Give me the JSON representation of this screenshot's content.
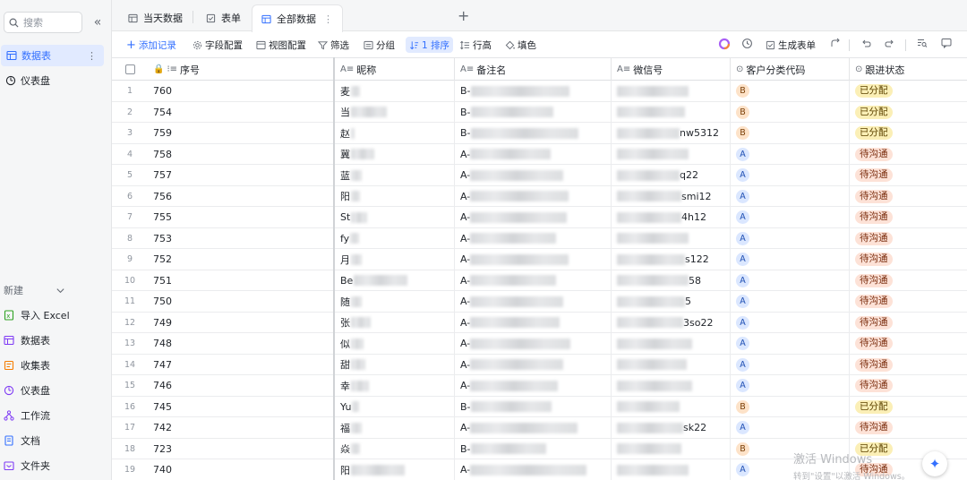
{
  "sidebar": {
    "search_placeholder": "搜索",
    "items": [
      {
        "label": "数据表",
        "icon": "table-icon",
        "active": true
      },
      {
        "label": "仪表盘",
        "icon": "dashboard-icon",
        "active": false
      }
    ],
    "new_label": "新建",
    "new_items": [
      {
        "label": "导入 Excel",
        "icon": "excel-icon",
        "color": "#2ea121"
      },
      {
        "label": "数据表",
        "icon": "table-icon",
        "color": "#7f3bf5"
      },
      {
        "label": "收集表",
        "icon": "form-icon",
        "color": "#f57c00"
      },
      {
        "label": "仪表盘",
        "icon": "dashboard-icon",
        "color": "#7f3bf5"
      },
      {
        "label": "工作流",
        "icon": "workflow-icon",
        "color": "#7f3bf5"
      },
      {
        "label": "文档",
        "icon": "doc-icon",
        "color": "#3370ff"
      },
      {
        "label": "文件夹",
        "icon": "folder-icon",
        "color": "#7f3bf5"
      }
    ]
  },
  "tabs": [
    {
      "label": "当天数据",
      "icon": "table-icon",
      "active": false
    },
    {
      "label": "表单",
      "icon": "form-icon",
      "active": false
    },
    {
      "label": "全部数据",
      "icon": "table-icon",
      "active": true
    }
  ],
  "toolbar": {
    "add_record": "添加记录",
    "field_config": "字段配置",
    "view_config": "视图配置",
    "filter": "筛选",
    "group": "分组",
    "sort": "1 排序",
    "row_height": "行高",
    "fill_color": "填色",
    "generate_form": "生成表单"
  },
  "columns": [
    "序号",
    "昵称",
    "备注名",
    "微信号",
    "客户分类代码",
    "跟进状态"
  ],
  "rows": [
    {
      "idx": "1",
      "num": "760",
      "nick": "麦",
      "remark": "B-",
      "wechat": "",
      "code": "B",
      "status": "已分配"
    },
    {
      "idx": "2",
      "num": "754",
      "nick": "当",
      "remark": "B-",
      "wechat": "",
      "code": "B",
      "status": "已分配"
    },
    {
      "idx": "3",
      "num": "759",
      "nick": "赵",
      "remark": "B-",
      "wechat": "nw5312",
      "code": "B",
      "status": "已分配"
    },
    {
      "idx": "4",
      "num": "758",
      "nick": "冀",
      "remark": "A-",
      "wechat": "",
      "code": "A",
      "status": "待沟通"
    },
    {
      "idx": "5",
      "num": "757",
      "nick": "蓝",
      "remark": "A-",
      "wechat": "q22",
      "code": "A",
      "status": "待沟通"
    },
    {
      "idx": "6",
      "num": "756",
      "nick": "阳",
      "remark": "A-",
      "wechat": "smi12",
      "code": "A",
      "status": "待沟通"
    },
    {
      "idx": "7",
      "num": "755",
      "nick": "St",
      "remark": "A-",
      "wechat": "4h12",
      "code": "A",
      "status": "待沟通"
    },
    {
      "idx": "8",
      "num": "753",
      "nick": "fy",
      "remark": "A-",
      "wechat": "",
      "code": "A",
      "status": "待沟通"
    },
    {
      "idx": "9",
      "num": "752",
      "nick": "月",
      "remark": "A-",
      "wechat": "s122",
      "code": "A",
      "status": "待沟通"
    },
    {
      "idx": "10",
      "num": "751",
      "nick": "Be",
      "remark": "A-",
      "wechat": "58",
      "code": "A",
      "status": "待沟通"
    },
    {
      "idx": "11",
      "num": "750",
      "nick": "随",
      "remark": "A-",
      "wechat": "5",
      "code": "A",
      "status": "待沟通"
    },
    {
      "idx": "12",
      "num": "749",
      "nick": "张",
      "remark": "A-",
      "wechat": "3so22",
      "code": "A",
      "status": "待沟通"
    },
    {
      "idx": "13",
      "num": "748",
      "nick": "似",
      "remark": "A-",
      "wechat": "",
      "code": "A",
      "status": "待沟通"
    },
    {
      "idx": "14",
      "num": "747",
      "nick": "甜",
      "remark": "A-",
      "wechat": "",
      "code": "A",
      "status": "待沟通"
    },
    {
      "idx": "15",
      "num": "746",
      "nick": "幸",
      "remark": "A-",
      "wechat": "",
      "code": "A",
      "status": "待沟通"
    },
    {
      "idx": "16",
      "num": "745",
      "nick": "Yu",
      "remark": "B-",
      "wechat": "",
      "code": "B",
      "status": "已分配"
    },
    {
      "idx": "17",
      "num": "742",
      "nick": "福",
      "remark": "A-",
      "wechat": "sk22",
      "code": "A",
      "status": "待沟通"
    },
    {
      "idx": "18",
      "num": "723",
      "nick": "焱",
      "remark": "B-",
      "wechat": "",
      "code": "B",
      "status": "已分配"
    },
    {
      "idx": "19",
      "num": "740",
      "nick": "阳",
      "remark": "A-",
      "wechat": "",
      "code": "A",
      "status": "待沟通"
    }
  ],
  "watermark": {
    "line1": "激活 Windows",
    "line2": "转到\"设置\"以激活 Windows。"
  },
  "colors": {
    "accent": "#3370ff",
    "sidebar_bg": "#f5f6f7"
  }
}
